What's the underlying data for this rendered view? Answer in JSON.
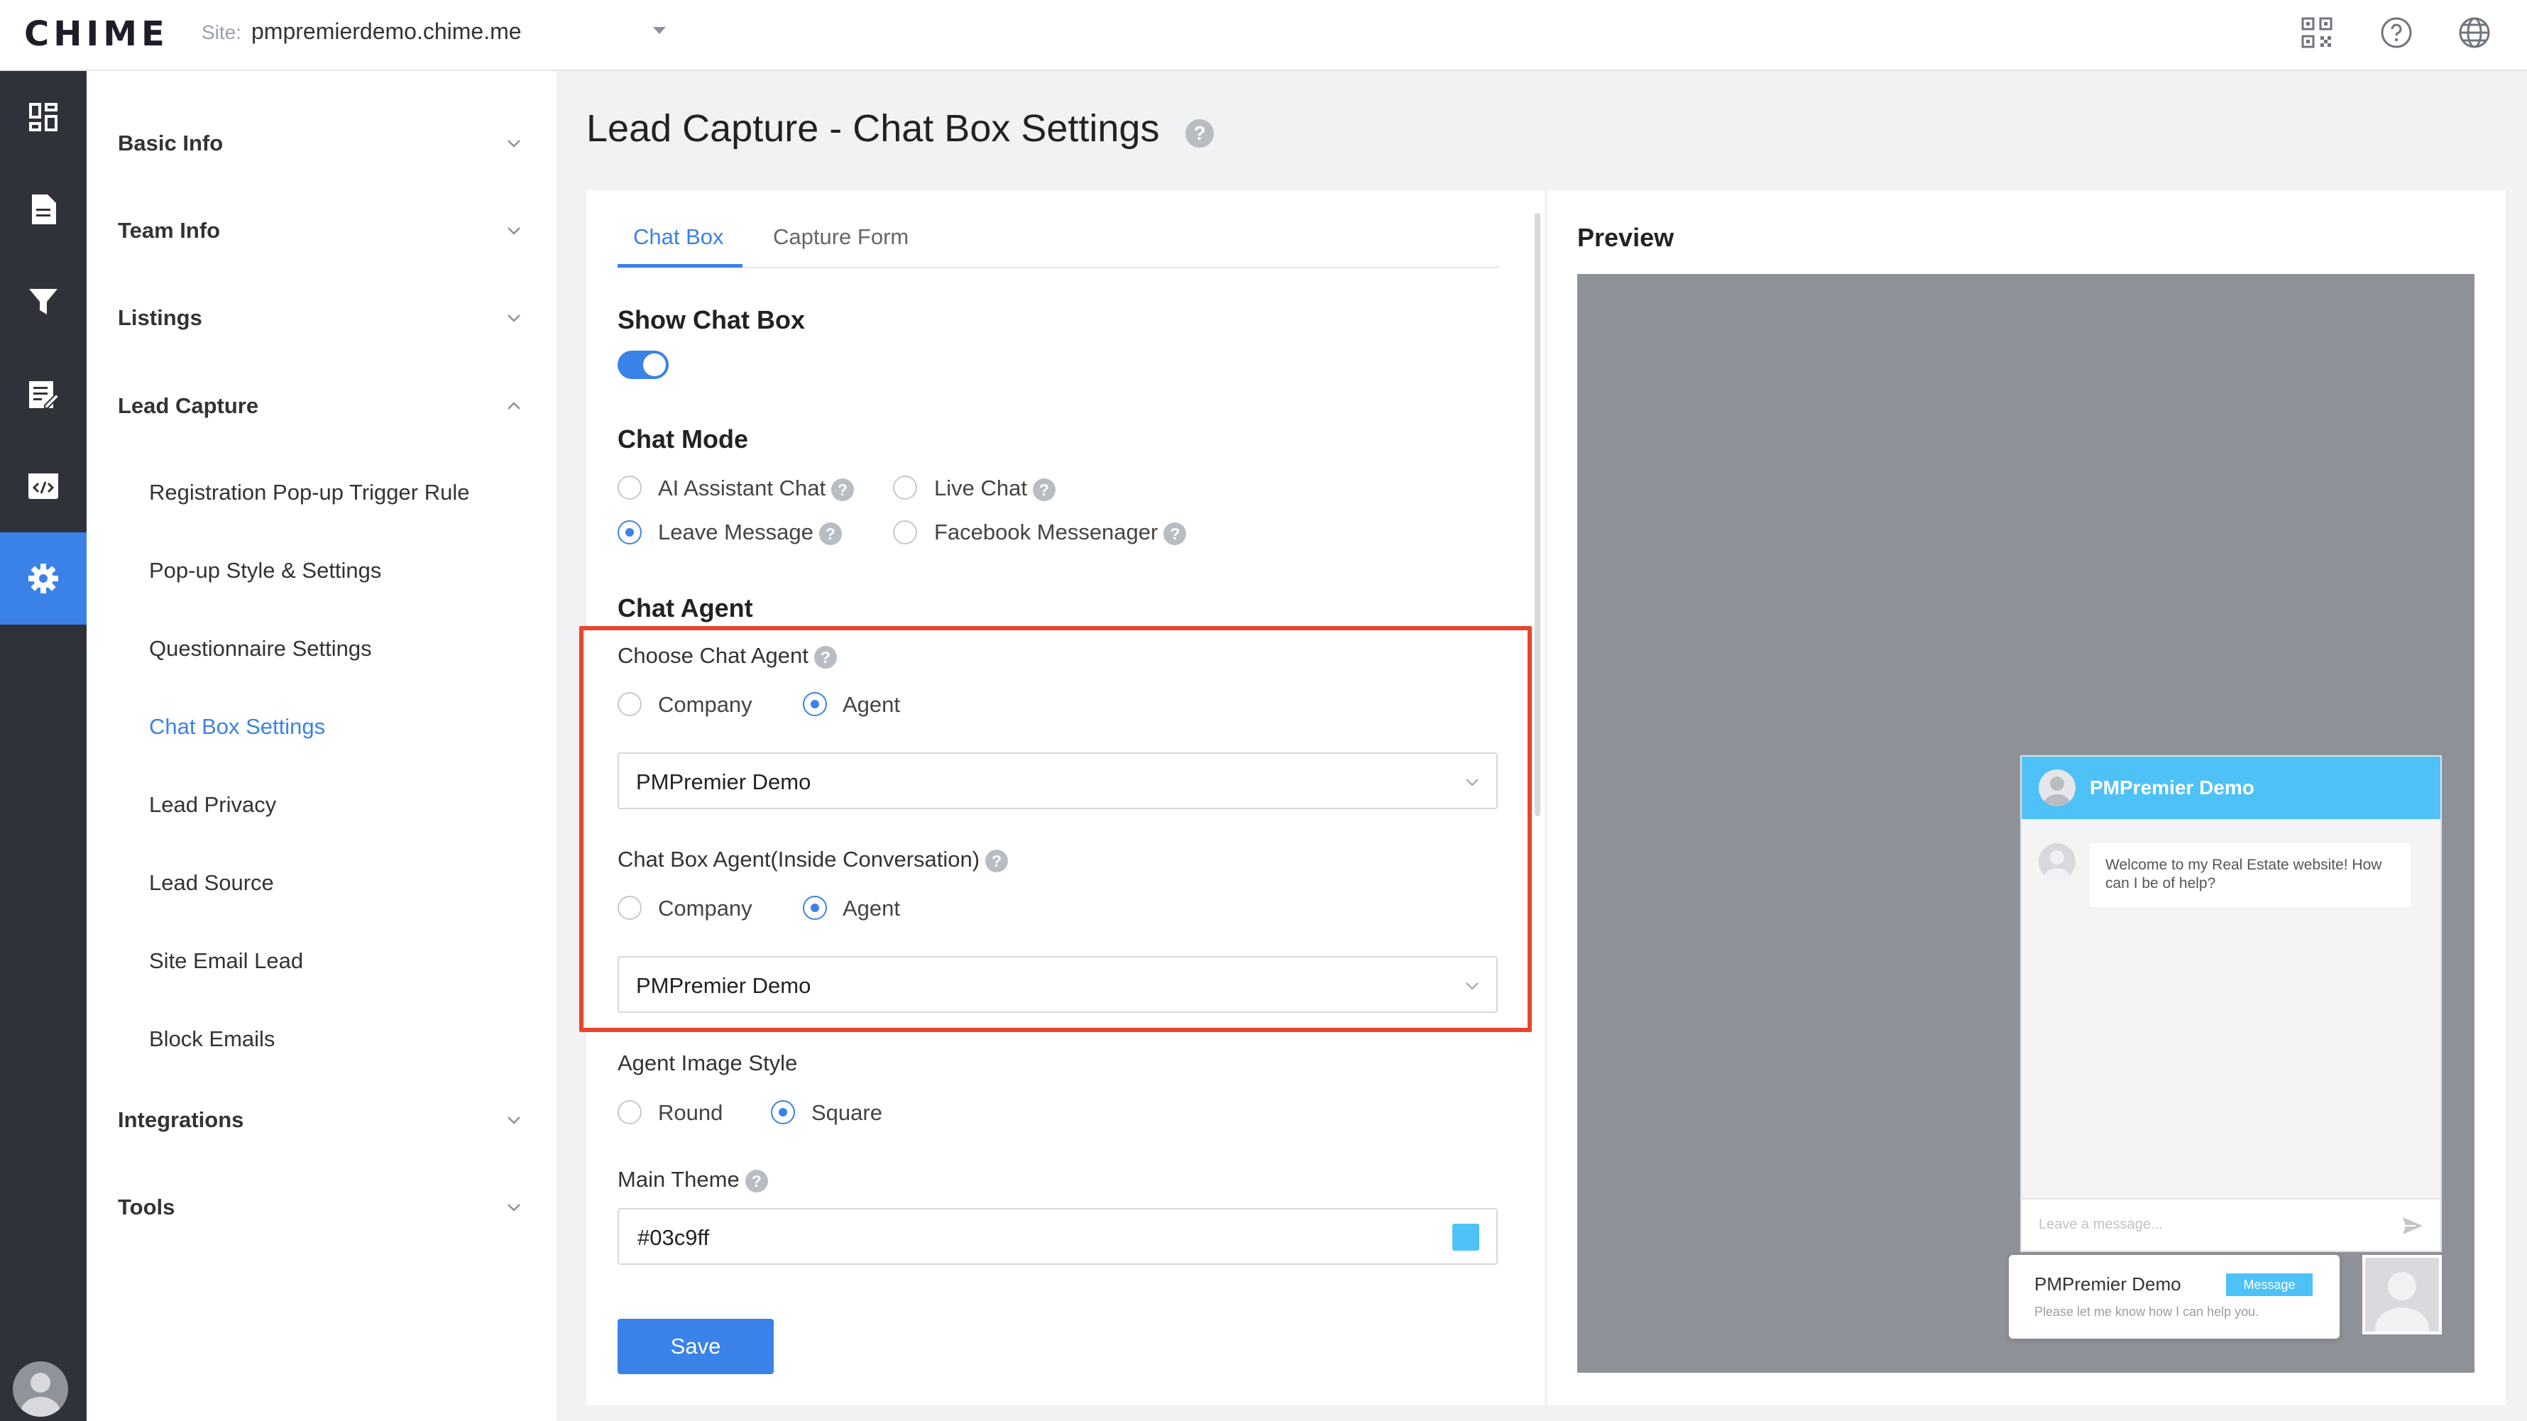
{
  "app": {
    "logo": "CHIME",
    "site_label": "Site:",
    "site_value": "pmpremierdemo.chime.me"
  },
  "topbar_icons": [
    "qr-code-icon",
    "help-circle-icon",
    "globe-icon"
  ],
  "rail": {
    "items": [
      "dashboard-icon",
      "document-icon",
      "filter-icon",
      "edit-list-icon",
      "code-icon",
      "gear-icon"
    ],
    "active": "gear-icon"
  },
  "sidebar": {
    "groups": [
      {
        "label": "Basic Info",
        "expanded": false
      },
      {
        "label": "Team Info",
        "expanded": false
      },
      {
        "label": "Listings",
        "expanded": false
      },
      {
        "label": "Lead Capture",
        "expanded": true
      },
      {
        "label": "Integrations",
        "expanded": false
      },
      {
        "label": "Tools",
        "expanded": false
      }
    ],
    "lead_capture_items": [
      "Registration Pop-up Trigger Rule",
      "Pop-up Style & Settings",
      "Questionnaire Settings",
      "Chat Box Settings",
      "Lead Privacy",
      "Lead Source",
      "Site Email Lead",
      "Block Emails"
    ],
    "active_item": "Chat Box Settings"
  },
  "page": {
    "title": "Lead Capture - Chat Box Settings",
    "help": "?"
  },
  "tabs": [
    {
      "label": "Chat Box",
      "active": true
    },
    {
      "label": "Capture Form",
      "active": false
    }
  ],
  "settings": {
    "show_chat_box": {
      "label": "Show Chat Box",
      "enabled": true
    },
    "chat_mode": {
      "label": "Chat Mode",
      "options": [
        {
          "label": "AI Assistant Chat",
          "selected": false
        },
        {
          "label": "Live Chat",
          "selected": false
        },
        {
          "label": "Leave Message",
          "selected": true
        },
        {
          "label": "Facebook Messenager",
          "selected": false
        }
      ]
    },
    "chat_agent": {
      "label": "Chat Agent",
      "choose_label": "Choose Chat Agent",
      "choose_options": [
        {
          "label": "Company",
          "selected": false
        },
        {
          "label": "Agent",
          "selected": true
        }
      ],
      "choose_value": "PMPremier Demo",
      "inside_label": "Chat Box Agent(Inside Conversation)",
      "inside_options": [
        {
          "label": "Company",
          "selected": false
        },
        {
          "label": "Agent",
          "selected": true
        }
      ],
      "inside_value": "PMPremier Demo"
    },
    "agent_image_style": {
      "label": "Agent Image Style",
      "options": [
        {
          "label": "Round",
          "selected": false
        },
        {
          "label": "Square",
          "selected": true
        }
      ]
    },
    "main_theme": {
      "label": "Main Theme",
      "value": "#03c9ff"
    },
    "save_label": "Save"
  },
  "preview": {
    "title": "Preview",
    "header_name": "PMPremier Demo",
    "welcome_message": "Welcome to my Real Estate website! How can I be of help?",
    "input_placeholder": "Leave a message...",
    "card_name": "PMPremier Demo",
    "card_badge": "Message",
    "card_subtitle": "Please let me know how I can help you."
  },
  "colors": {
    "accent": "#3b82e8",
    "highlight": "#e8452c",
    "theme": "#4ec2f7",
    "preview_background": "#8f9198"
  }
}
